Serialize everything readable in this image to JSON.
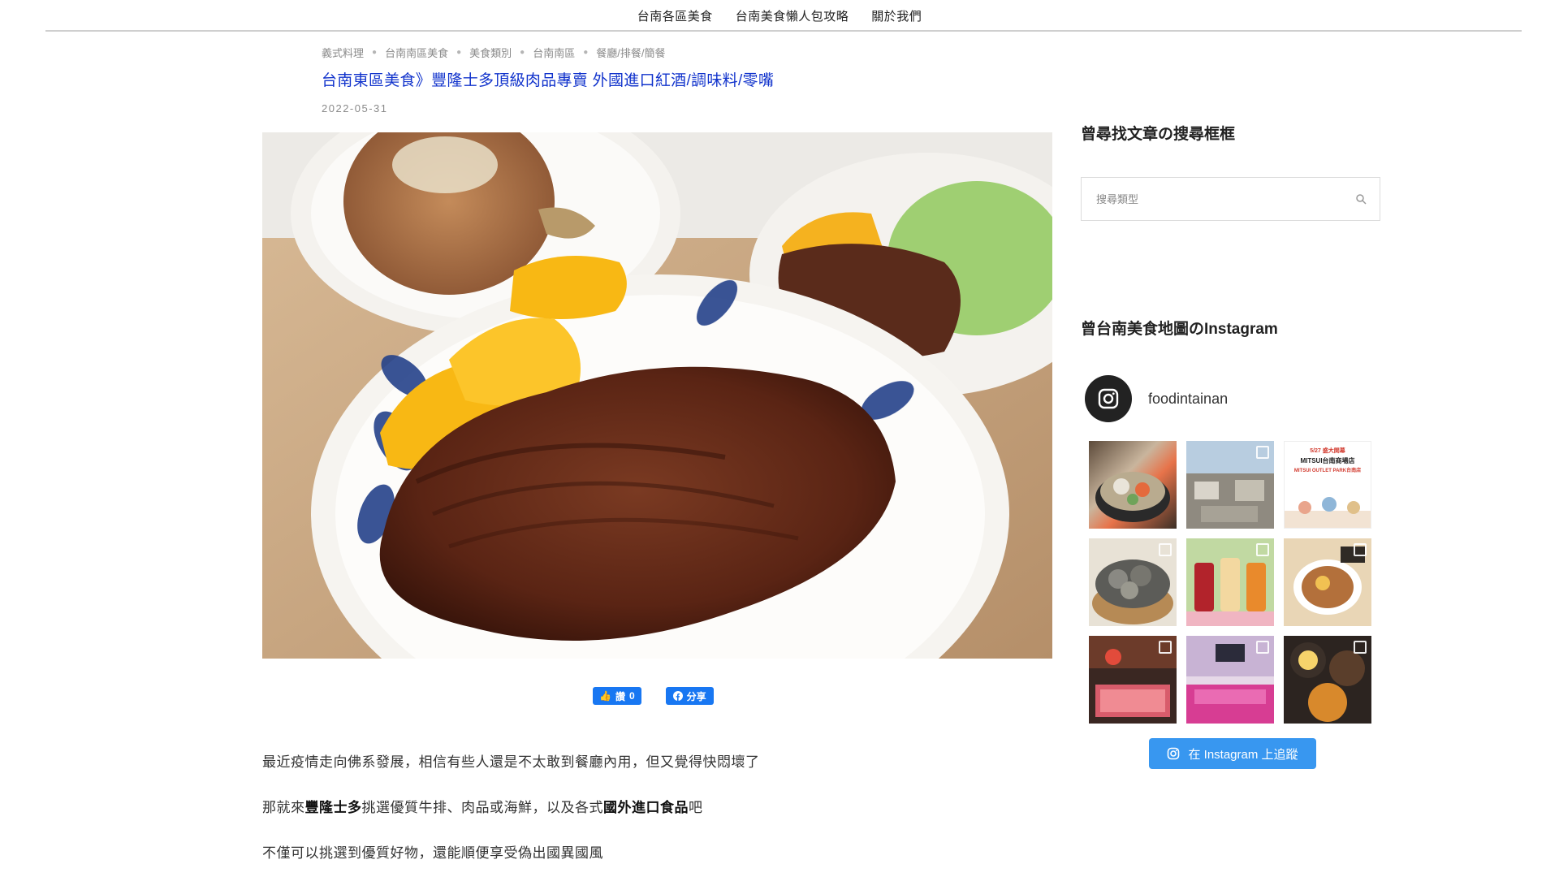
{
  "nav": {
    "items": [
      "台南各區美食",
      "台南美食懶人包攻略",
      "關於我們"
    ]
  },
  "post": {
    "categories": [
      "義式料理",
      "台南南區美食",
      "美食類別",
      "台南南區",
      "餐廳/排餐/簡餐"
    ],
    "title": "台南東區美食》豐隆士多頂級肉品專賣 外國進口紅酒/調味料/零嘴",
    "date": "2022-05-31"
  },
  "social": {
    "like_label": "讚",
    "like_count": "0",
    "share_label": "分享"
  },
  "body": {
    "p1": "最近疫情走向佛系發展，相信有些人還是不太敢到餐廳內用，但又覺得快悶壞了",
    "p2_a": "那就來",
    "p2_b": "豐隆士多",
    "p2_c": "挑選優質牛排、肉品或海鮮，以及各式",
    "p2_d": "國外進口食品",
    "p2_e": "吧",
    "p3": "不僅可以挑選到優質好物，還能順便享受偽出國異國風"
  },
  "sidebar": {
    "search_title": "曾尋找文章の搜尋框框",
    "search_placeholder": "搜尋類型",
    "ig_title_a": "曾台南美食地圖の",
    "ig_title_b": "Instagram",
    "ig_username": "foodintainan",
    "ig_follow_label": "在 Instagram 上追蹤",
    "ig_post3_line1": "5/27 盛大開幕",
    "ig_post3_line2": "MITSUI台南商場店",
    "ig_post3_line3": "MITSUI OUTLET PARK台南店"
  },
  "colors": {
    "title_link": "#1133cc",
    "facebook": "#1877f2",
    "instagram_button": "#3897f0"
  }
}
